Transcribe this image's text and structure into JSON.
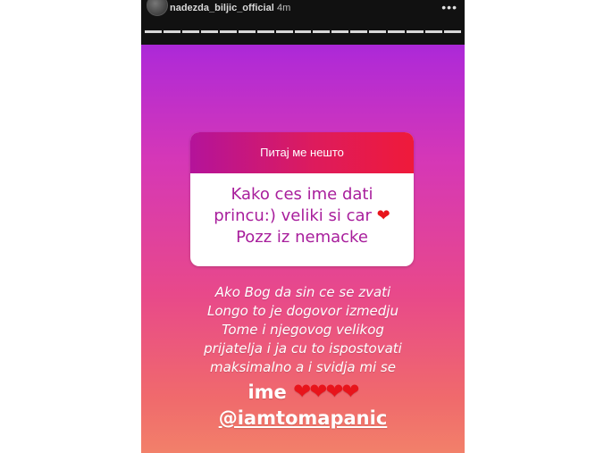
{
  "header": {
    "username": "nadezda_biljic_official",
    "time": "4m",
    "more": "•••",
    "segments": 17
  },
  "question": {
    "prompt": "Питај ме нешто",
    "line1": "Kako ces ime dati",
    "line2": "princu:) veliki si car",
    "line3": "Pozz iz nemacke",
    "heart": "❤"
  },
  "answer": {
    "line1": "Ako Bog da sin ce se zvati",
    "line2": "Longo to je dogovor izmedju",
    "line3": "Tome i njegovog velikog",
    "line4": "prijatelja i ja cu to ispostovati",
    "line5": "maksimalno a i svidja mi se",
    "line6": "ime",
    "hearts": "❤❤❤❤",
    "mention": "@iamtomapanic"
  },
  "colors": {
    "gradient_top": "#8a1dd6",
    "gradient_bottom": "#f2806a",
    "question_text": "#a81e9c",
    "heart": "#e8141b"
  }
}
